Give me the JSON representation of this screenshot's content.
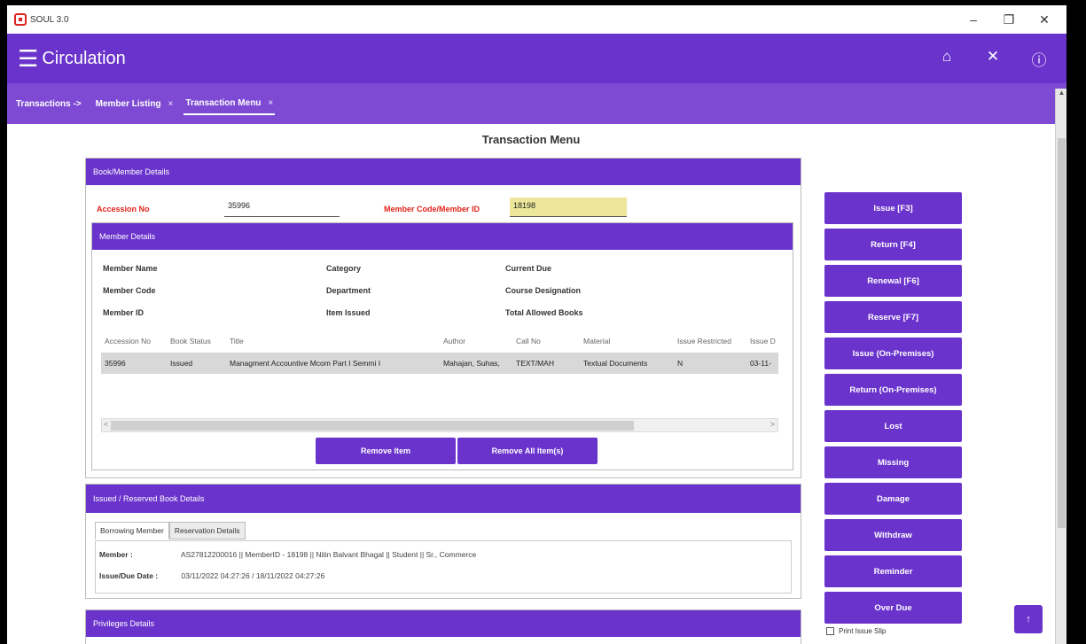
{
  "window": {
    "app_title": "SOUL 3.0",
    "minimize": "–",
    "restore": "❐",
    "close": "✕"
  },
  "header": {
    "title": "Circulation",
    "home_icon": "home-icon",
    "close_icon": "close-icon",
    "help_icon": "help-icon"
  },
  "tabbar": {
    "crumb": "Transactions ->",
    "tabs": [
      {
        "label": "Member Listing",
        "close": "×"
      },
      {
        "label": "Transaction Menu",
        "close": "×"
      }
    ]
  },
  "page_title": "Transaction Menu",
  "book_member": {
    "header": "Book/Member Details",
    "accession_label": "Accession No",
    "accession_value": "35996",
    "member_code_label": "Member Code/Member ID",
    "member_code_value": "18198"
  },
  "member_details": {
    "header": "Member Details",
    "labels": {
      "member_name": "Member Name",
      "member_code": "Member Code",
      "member_id": "Member ID",
      "category": "Category",
      "department": "Department",
      "item_issued": "Item Issued",
      "current_due": "Current Due",
      "course_designation": "Course Designation",
      "total_allowed": "Total Allowed Books"
    },
    "columns": [
      "Accession No",
      "Book Status",
      "Title",
      "Author",
      "Call No",
      "Material",
      "Issue Restricted",
      "Issue D"
    ],
    "rows": [
      [
        "35996",
        "Issued",
        "Managment Accountive Mcom Part I Semmi I",
        "Mahajan, Suhas,",
        "TEXT/MAH",
        "Textual Documents",
        "N",
        "03-11-"
      ]
    ],
    "scroll_left": "<",
    "scroll_right": ">",
    "remove_item": "Remove Item",
    "remove_all": "Remove All Item(s)"
  },
  "issued_reserved": {
    "header": "Issued / Reserved Book Details",
    "tabs": [
      "Borrowing Member",
      "Reservation Details"
    ],
    "member_label": "Member :",
    "member_value": "AS27812200016 || MemberID - 18198 || Nitin Balvant Bhagal || Student || Sr., Commerce",
    "date_label": "Issue/Due Date :",
    "date_value": "03/11/2022 04:27:26 / 18/11/2022 04:27:26"
  },
  "privileges": {
    "header": "Privileges Details"
  },
  "actions": [
    "Issue [F3]",
    "Return [F4]",
    "Renewal [F6]",
    "Reserve [F7]",
    "Issue (On-Premises)",
    "Return (On-Premises)",
    "Lost",
    "Missing",
    "Damage",
    "Withdraw",
    "Reminder",
    "Over Due"
  ],
  "print_issue_slip": "Print Issue Slip",
  "scroll_up": "↑"
}
